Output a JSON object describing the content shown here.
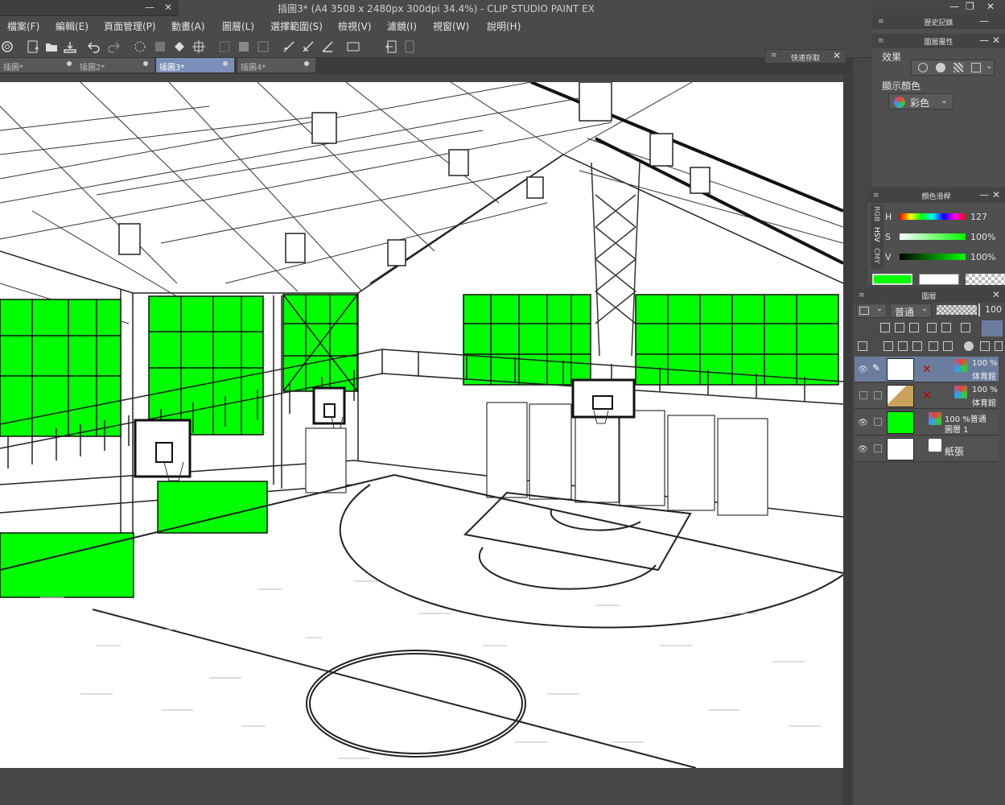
{
  "window": {
    "title": "插圖3* (A4 3508 x 2480px 300dpi 34.4%)  - CLIP STUDIO PAINT EX",
    "controls": [
      "—",
      "❐",
      "✕"
    ]
  },
  "menu": [
    "檔案(F)",
    "編輯(E)",
    "頁面管理(P)",
    "動畫(A)",
    "圖層(L)",
    "選擇範圍(S)",
    "檢視(V)",
    "濾鏡(I)",
    "視窗(W)",
    "說明(H)"
  ],
  "tabs": [
    {
      "label": "插圖*",
      "active": false
    },
    {
      "label": "插圖2*",
      "active": false
    },
    {
      "label": "插圖3*",
      "active": true
    },
    {
      "label": "插圖4*",
      "active": false
    }
  ],
  "quick_save": {
    "title": "快速存取"
  },
  "panels": {
    "history": {
      "title": "歷史記錄"
    },
    "layer_property": {
      "title": "圖層屬性",
      "effect_label": "效果",
      "display_color_label": "顯示顏色",
      "display_color_value": "彩色"
    },
    "color_slider": {
      "title": "顏色滑桿",
      "tabs": [
        "RGB",
        "HSV",
        "CMY"
      ],
      "h_label": "H",
      "h_value": "127",
      "s_label": "S",
      "s_value": "100",
      "v_label": "V",
      "v_value": "100",
      "percent": "%"
    },
    "layers": {
      "title": "圖層",
      "blend_mode": "普通",
      "opacity": "100",
      "items": [
        {
          "line1": "100 %",
          "line2": "体育館",
          "selected": true
        },
        {
          "line1": "100 %",
          "line2": "体育館",
          "selected": false
        },
        {
          "line1": "100 %普通",
          "line2": "圖層 1",
          "selected": false
        },
        {
          "line1": "紙張",
          "line2": "",
          "selected": false
        }
      ]
    }
  },
  "colors": {
    "accent_green": "#00ff00",
    "tab_active": "#7b8fb8",
    "layer_selected": "#6b7d9f"
  }
}
